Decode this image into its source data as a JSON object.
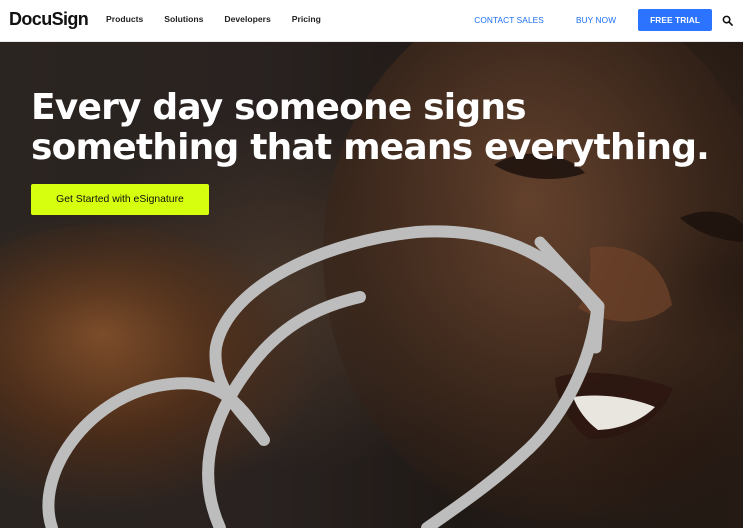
{
  "header": {
    "logo": "DocuSign",
    "nav": [
      "Products",
      "Solutions",
      "Developers",
      "Pricing"
    ],
    "contact_sales": "CONTACT SALES",
    "buy_now": "BUY NOW",
    "free_trial": "FREE TRIAL"
  },
  "hero": {
    "headline_line1": "Every day someone signs",
    "headline_line2": "something that means everything.",
    "cta": "Get Started with eSignature"
  },
  "icons": {
    "search": "search-icon",
    "signature": "signature-arrow-graphic"
  },
  "colors": {
    "brand_blue": "#2c74ff",
    "link_blue": "#1b6ef3",
    "cta_lime": "#d5ff0f",
    "hero_text": "#ffffff"
  }
}
